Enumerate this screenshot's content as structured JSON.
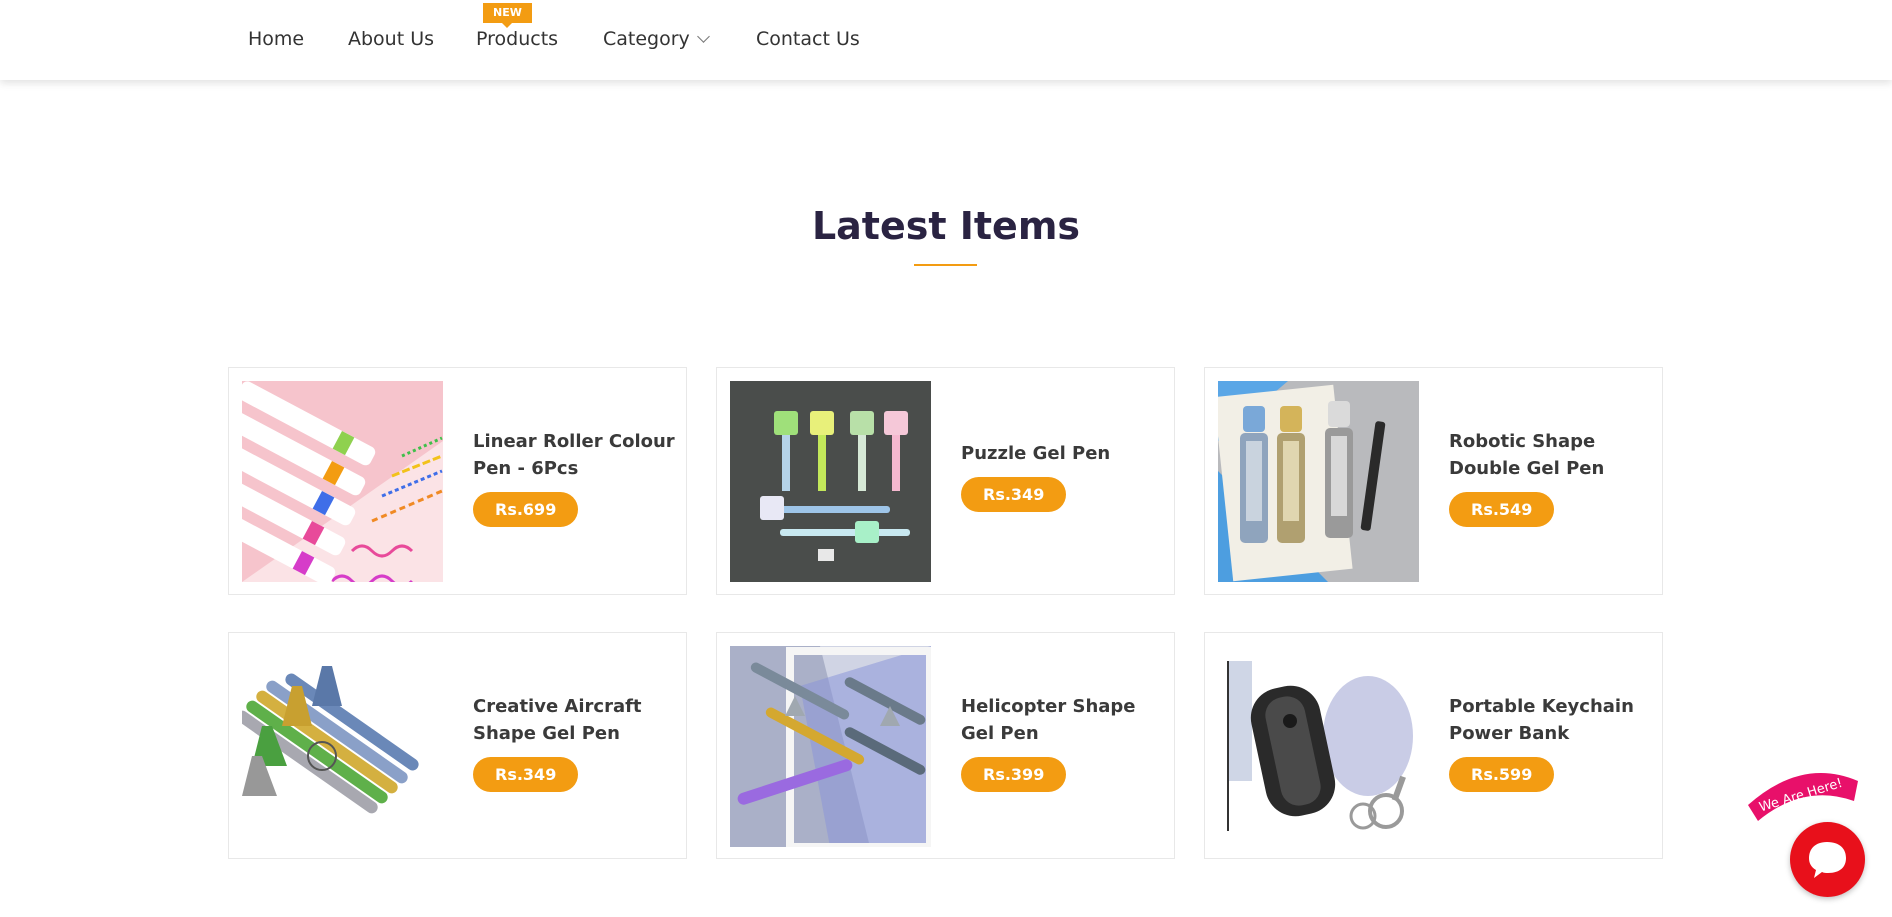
{
  "nav": {
    "items": [
      {
        "label": "Home"
      },
      {
        "label": "About Us"
      },
      {
        "label": "Products",
        "badge": "NEW"
      },
      {
        "label": "Category",
        "has_dropdown": true
      },
      {
        "label": "Contact Us"
      }
    ]
  },
  "section": {
    "title": "Latest Items"
  },
  "products": [
    {
      "name": "Linear Roller Colour Pen - 6Pcs",
      "price": "Rs.699"
    },
    {
      "name": "Puzzle Gel Pen",
      "price": "Rs.349"
    },
    {
      "name": "Robotic Shape Double Gel Pen",
      "price": "Rs.549"
    },
    {
      "name": "Creative Aircraft Shape Gel Pen",
      "price": "Rs.349"
    },
    {
      "name": "Helicopter Shape Gel Pen",
      "price": "Rs.399"
    },
    {
      "name": "Portable Keychain Power Bank",
      "price": "Rs.599"
    }
  ],
  "chat": {
    "tag_label": "We Are Here!"
  },
  "colors": {
    "accent": "#f39c12",
    "title": "#2a2342",
    "chat": "#e8101b",
    "tag": "#e8106a"
  },
  "icons": {
    "category_dropdown": "chevron-down-icon",
    "chat": "chat-bubble-icon"
  }
}
